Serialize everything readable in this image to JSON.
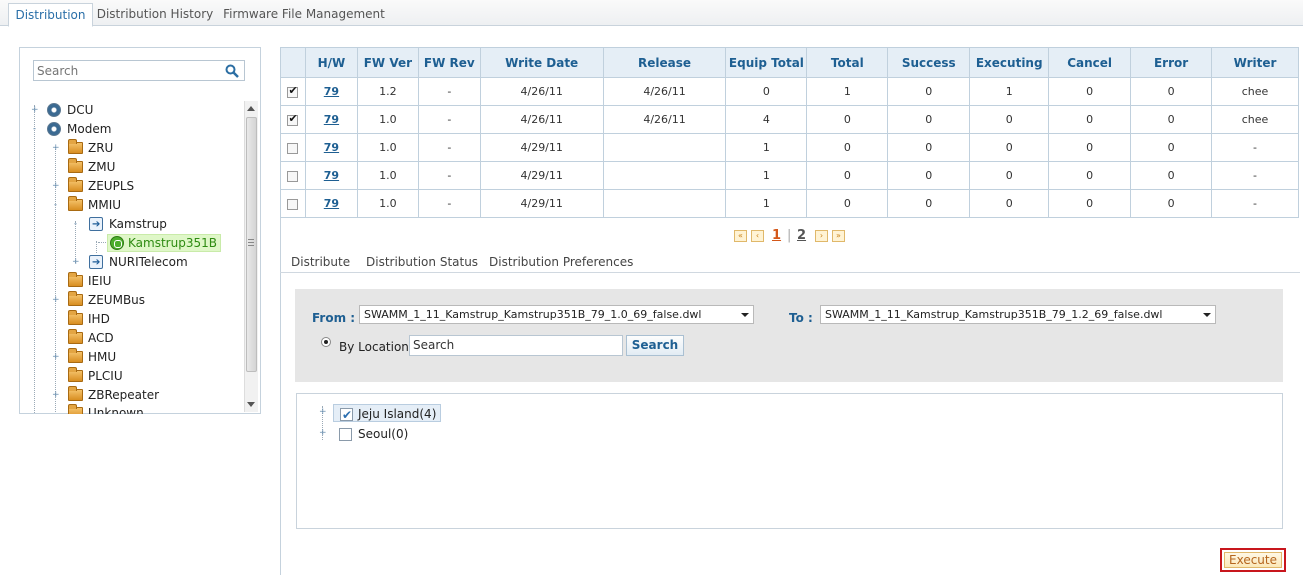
{
  "top_tabs": [
    {
      "label": "Distribution",
      "active": true
    },
    {
      "label": "Distribution History",
      "active": false
    },
    {
      "label": "Firmware File Management",
      "active": false
    }
  ],
  "tree": {
    "search_placeholder": "Search",
    "nodes": [
      {
        "label": "DCU",
        "icon": "db-icon",
        "expander": "+"
      },
      {
        "label": "Modem",
        "icon": "db-icon",
        "expander": "-"
      },
      {
        "label": "ZRU",
        "icon": "folder-icon",
        "expander": "+"
      },
      {
        "label": "ZMU",
        "icon": "folder-icon",
        "expander": ""
      },
      {
        "label": "ZEUPLS",
        "icon": "folder-icon",
        "expander": "+"
      },
      {
        "label": "MMIU",
        "icon": "folder-icon",
        "expander": "-"
      },
      {
        "label": "Kamstrup",
        "icon": "device-icon",
        "expander": "-"
      },
      {
        "label": "Kamstrup351B",
        "icon": "meter-icon",
        "expander": "",
        "selected": true
      },
      {
        "label": "NURITelecom",
        "icon": "device-icon",
        "expander": "+"
      },
      {
        "label": "IEIU",
        "icon": "folder-icon",
        "expander": ""
      },
      {
        "label": "ZEUMBus",
        "icon": "folder-icon",
        "expander": "+"
      },
      {
        "label": "IHD",
        "icon": "folder-icon",
        "expander": ""
      },
      {
        "label": "ACD",
        "icon": "folder-icon",
        "expander": ""
      },
      {
        "label": "HMU",
        "icon": "folder-icon",
        "expander": "+"
      },
      {
        "label": "PLCIU",
        "icon": "folder-icon",
        "expander": ""
      },
      {
        "label": "ZBRepeater",
        "icon": "folder-icon",
        "expander": "+"
      },
      {
        "label": "Unknown",
        "icon": "folder-icon",
        "expander": ""
      }
    ]
  },
  "table": {
    "headers": [
      "H/W",
      "FW Ver",
      "FW Rev",
      "Write Date",
      "Release",
      "Equip Total",
      "Total",
      "Success",
      "Executing",
      "Cancel",
      "Error",
      "Writer"
    ],
    "rows": [
      {
        "checked": true,
        "cells": [
          "79",
          "1.2",
          "-",
          "4/26/11",
          "4/26/11",
          "0",
          "1",
          "0",
          "1",
          "0",
          "0",
          "chee"
        ]
      },
      {
        "checked": true,
        "cells": [
          "79",
          "1.0",
          "-",
          "4/26/11",
          "4/26/11",
          "4",
          "0",
          "0",
          "0",
          "0",
          "0",
          "chee"
        ]
      },
      {
        "checked": false,
        "cells": [
          "79",
          "1.0",
          "-",
          "4/29/11",
          "",
          "1",
          "0",
          "0",
          "0",
          "0",
          "0",
          "-"
        ]
      },
      {
        "checked": false,
        "cells": [
          "79",
          "1.0",
          "-",
          "4/29/11",
          "",
          "1",
          "0",
          "0",
          "0",
          "0",
          "0",
          "-"
        ]
      },
      {
        "checked": false,
        "cells": [
          "79",
          "1.0",
          "-",
          "4/29/11",
          "",
          "1",
          "0",
          "0",
          "0",
          "0",
          "0",
          "-"
        ]
      }
    ]
  },
  "pager": {
    "first": "«",
    "prev": "‹",
    "current": "1",
    "separator": "|",
    "other": "2",
    "next": "›",
    "last": "»"
  },
  "sub_tabs": [
    "Distribute",
    "Distribution Status",
    "Distribution Preferences"
  ],
  "form": {
    "from_label": "From :",
    "from_value": "SWAMM_1_11_Kamstrup_Kamstrup351B_79_1.0_69_false.dwl",
    "to_label": "To :",
    "to_value": "SWAMM_1_11_Kamstrup_Kamstrup351B_79_1.2_69_false.dwl",
    "by_location_label": "By Location",
    "location_search_placeholder": "Search",
    "search_button": "Search"
  },
  "locations": [
    {
      "label": "Jeju Island(4)",
      "checked": true
    },
    {
      "label": "Seoul(0)",
      "checked": false
    }
  ],
  "execute_button": "Execute",
  "colors": {
    "accent": "#1e5f92",
    "header_bg": "#e5eef6",
    "execute_border": "#c8161d",
    "selected_node_bg": "#dff7c8"
  }
}
